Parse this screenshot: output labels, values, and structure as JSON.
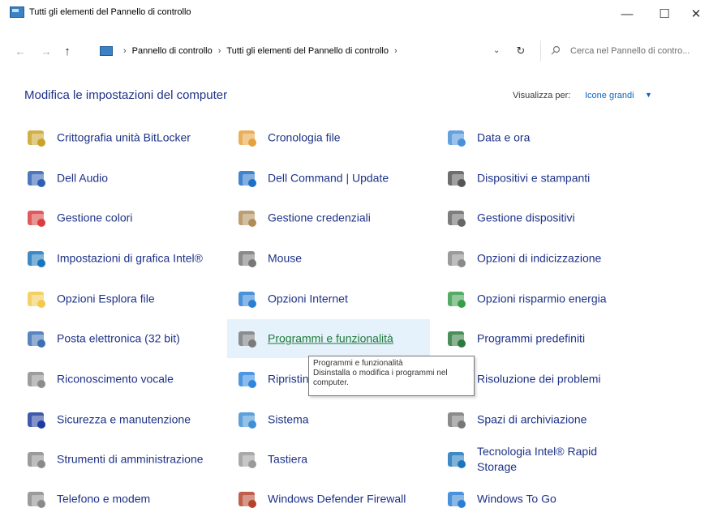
{
  "window": {
    "title": "Tutti gli elementi del Pannello di controllo",
    "minimize": "—",
    "maximize": "☐",
    "close": "✕"
  },
  "nav": {
    "back": "←",
    "forward": "→",
    "up": "↑",
    "breadcrumb": [
      "Pannello di controllo",
      "Tutti gli elementi del Pannello di controllo"
    ],
    "separator": "›",
    "dropdown": "⌄",
    "refresh": "↻",
    "search_placeholder": "Cerca nel Pannello di contro..."
  },
  "header": {
    "title": "Modifica le impostazioni del computer",
    "view_by_label": "Visualizza per:",
    "view_by_value": "Icone grandi",
    "view_caret": "▼"
  },
  "items": [
    {
      "label": "Crittografia unità BitLocker",
      "icon": "bitlocker-keys-icon",
      "color": "#c9a227"
    },
    {
      "label": "Cronologia file",
      "icon": "file-history-icon",
      "color": "#e6a23c"
    },
    {
      "label": "Data e ora",
      "icon": "date-time-icon",
      "color": "#4a90d9"
    },
    {
      "label": "Dell Audio",
      "icon": "dell-audio-icon",
      "color": "#2f5fb3"
    },
    {
      "label": "Dell Command | Update",
      "icon": "dell-command-update-icon",
      "color": "#1f6fc5"
    },
    {
      "label": "Dispositivi e stampanti",
      "icon": "printer-icon",
      "color": "#555555"
    },
    {
      "label": "Gestione colori",
      "icon": "color-management-icon",
      "color": "#d93d3d"
    },
    {
      "label": "Gestione credenziali",
      "icon": "credential-vault-icon",
      "color": "#b08d57"
    },
    {
      "label": "Gestione dispositivi",
      "icon": "device-manager-icon",
      "color": "#666666"
    },
    {
      "label": "Impostazioni di grafica Intel®",
      "icon": "intel-graphics-icon",
      "color": "#1b75bc"
    },
    {
      "label": "Mouse",
      "icon": "mouse-icon",
      "color": "#777777"
    },
    {
      "label": "Opzioni di indicizzazione",
      "icon": "indexing-icon",
      "color": "#8a8a8a"
    },
    {
      "label": "Opzioni Esplora file",
      "icon": "folder-options-icon",
      "color": "#f2c94c"
    },
    {
      "label": "Opzioni Internet",
      "icon": "internet-options-icon",
      "color": "#2a7fd4"
    },
    {
      "label": "Opzioni risparmio energia",
      "icon": "power-options-icon",
      "color": "#3a9d4a"
    },
    {
      "label": "Posta elettronica (32 bit)",
      "icon": "mail-icon",
      "color": "#3c6fb5"
    },
    {
      "label": "Programmi e funzionalità",
      "icon": "programs-features-icon",
      "color": "#7a7a7a"
    },
    {
      "label": "Programmi predefiniti",
      "icon": "default-programs-icon",
      "color": "#2b7a3d"
    },
    {
      "label": "Riconoscimento vocale",
      "icon": "microphone-icon",
      "color": "#8c8c8c"
    },
    {
      "label": "Ripristino",
      "icon": "recovery-icon",
      "color": "#2e86de"
    },
    {
      "label": "Risoluzione dei problemi",
      "icon": "troubleshooting-icon",
      "color": "#4a4a4a"
    },
    {
      "label": "Sicurezza e manutenzione",
      "icon": "security-flag-icon",
      "color": "#1e3c9e"
    },
    {
      "label": "Sistema",
      "icon": "system-icon",
      "color": "#3f8fd6"
    },
    {
      "label": "Spazi di archiviazione",
      "icon": "storage-spaces-icon",
      "color": "#777777"
    },
    {
      "label": "Strumenti di amministrazione",
      "icon": "admin-tools-icon",
      "color": "#8a8a8a"
    },
    {
      "label": "Tastiera",
      "icon": "keyboard-icon",
      "color": "#9a9a9a"
    },
    {
      "label": "Tecnologia Intel® Rapid Storage",
      "icon": "intel-rapid-storage-icon",
      "color": "#1b75bc"
    },
    {
      "label": "Telefono e modem",
      "icon": "phone-modem-icon",
      "color": "#8a8a8a"
    },
    {
      "label": "Windows Defender Firewall",
      "icon": "firewall-icon",
      "color": "#b5432b"
    },
    {
      "label": "Windows To Go",
      "icon": "windows-to-go-icon",
      "color": "#2a7fd4"
    }
  ],
  "tooltip": {
    "title": "Programmi e funzionalità",
    "text": "Disinstalla o modifica i programmi nel computer."
  }
}
